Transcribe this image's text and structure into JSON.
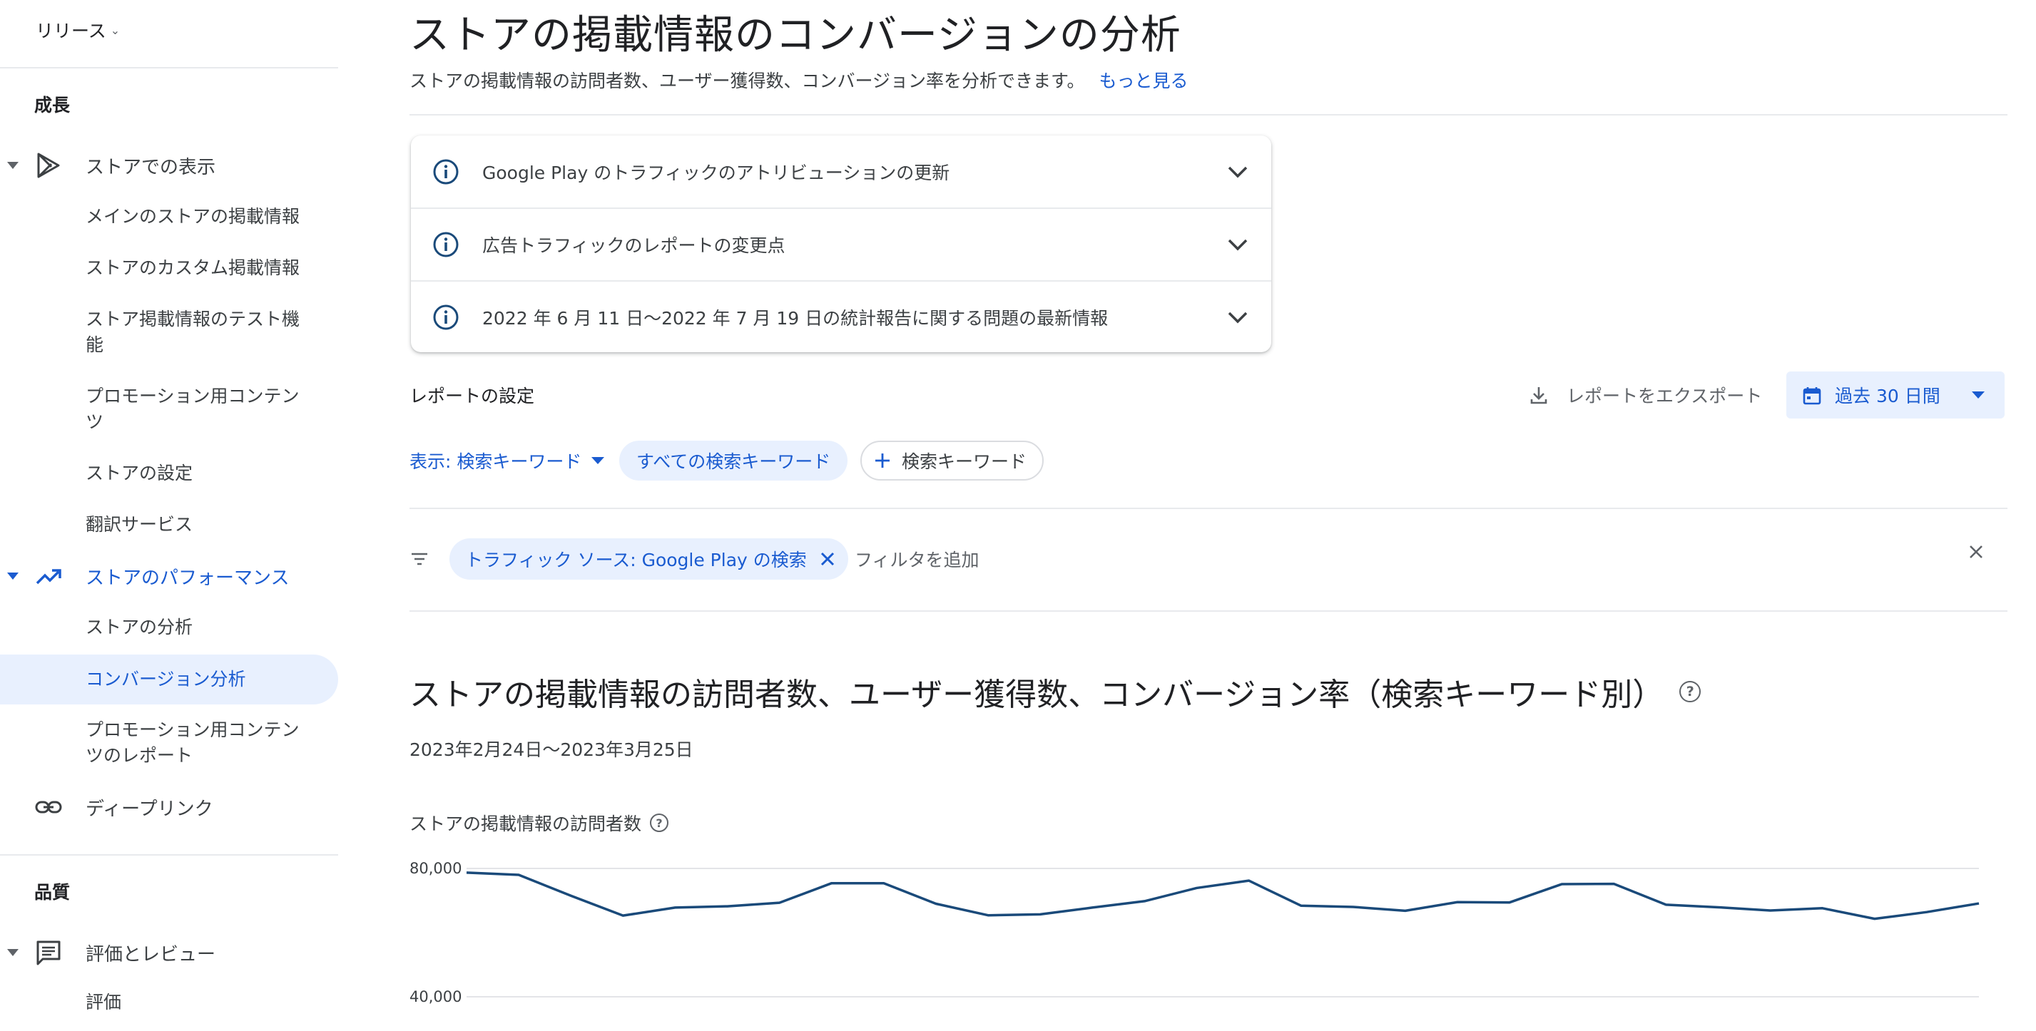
{
  "sidebar": {
    "release": "リリース",
    "growth_heading": "成長",
    "store_presence": {
      "label": "ストアでの表示",
      "items": [
        "メインのストアの掲載情報",
        "ストアのカスタム掲載情報",
        "ストア掲載情報のテスト機能",
        "プロモーション用コンテンツ",
        "ストアの設定",
        "翻訳サービス"
      ]
    },
    "store_performance": {
      "label": "ストアのパフォーマンス",
      "items": [
        "ストアの分析",
        "コンバージョン分析",
        "プロモーション用コンテンツのレポート"
      ],
      "selected": "コンバージョン分析"
    },
    "deep_links": "ディープリンク",
    "quality_heading": "品質",
    "ratings_reviews": {
      "label": "評価とレビュー",
      "items": [
        "評価"
      ]
    }
  },
  "page": {
    "title": "ストアの掲載情報のコンバージョンの分析",
    "subtitle": "ストアの掲載情報の訪問者数、ユーザー獲得数、コンバージョン率を分析できます。",
    "learn_more": "もっと見る"
  },
  "notices": [
    {
      "text": "Google Play のトラフィックのアトリビューションの更新",
      "icon": "info-icon"
    },
    {
      "text": "広告トラフィックのレポートの変更点",
      "icon": "info-icon"
    },
    {
      "text": "2022 年 6 月 11 日〜2022 年 7 月 19 日の統計報告に関する問題の最新情報",
      "icon": "info-icon"
    }
  ],
  "report_settings": {
    "title": "レポートの設定",
    "export": "レポートをエクスポート",
    "date_range": "過去 30 日間",
    "view_label": "表示: 検索キーワード",
    "selected_chip": "すべての検索キーワード",
    "add_chip": "検索キーワード",
    "filter_chip": "トラフィック ソース: Google Play の検索",
    "add_filter_placeholder": "フィルタを追加"
  },
  "section": {
    "title": "ストアの掲載情報の訪問者数、ユーザー獲得数、コンバージョン率（検索キーワード別）",
    "date_range": "2023年2月24日〜2023年3月25日"
  },
  "chart_data": {
    "type": "line",
    "title": "ストアの掲載情報の訪問者数",
    "y_ticks": [
      "80,000",
      "40,000"
    ],
    "ylim": [
      40000,
      80000
    ],
    "x": [
      1,
      2,
      3,
      4,
      5,
      6,
      7,
      8,
      9,
      10,
      11,
      12,
      13,
      14,
      15,
      16,
      17,
      18,
      19,
      20,
      21,
      22,
      23,
      24,
      25,
      26,
      27,
      28,
      29,
      30
    ],
    "series": [
      {
        "values": [
          78700,
          78000,
          71500,
          65300,
          67800,
          68200,
          69300,
          75400,
          75400,
          69000,
          65400,
          65700,
          67800,
          69800,
          73900,
          76200,
          68400,
          68000,
          66800,
          69500,
          69400,
          75100,
          75200,
          68700,
          67900,
          66900,
          67600,
          64300,
          66400,
          69100
        ],
        "color": "#1a4a7a"
      }
    ],
    "grid": true
  },
  "colors": {
    "accent": "#1a5bd0",
    "selected_bg": "#e8f0fe",
    "line": "#1a4a7a"
  }
}
